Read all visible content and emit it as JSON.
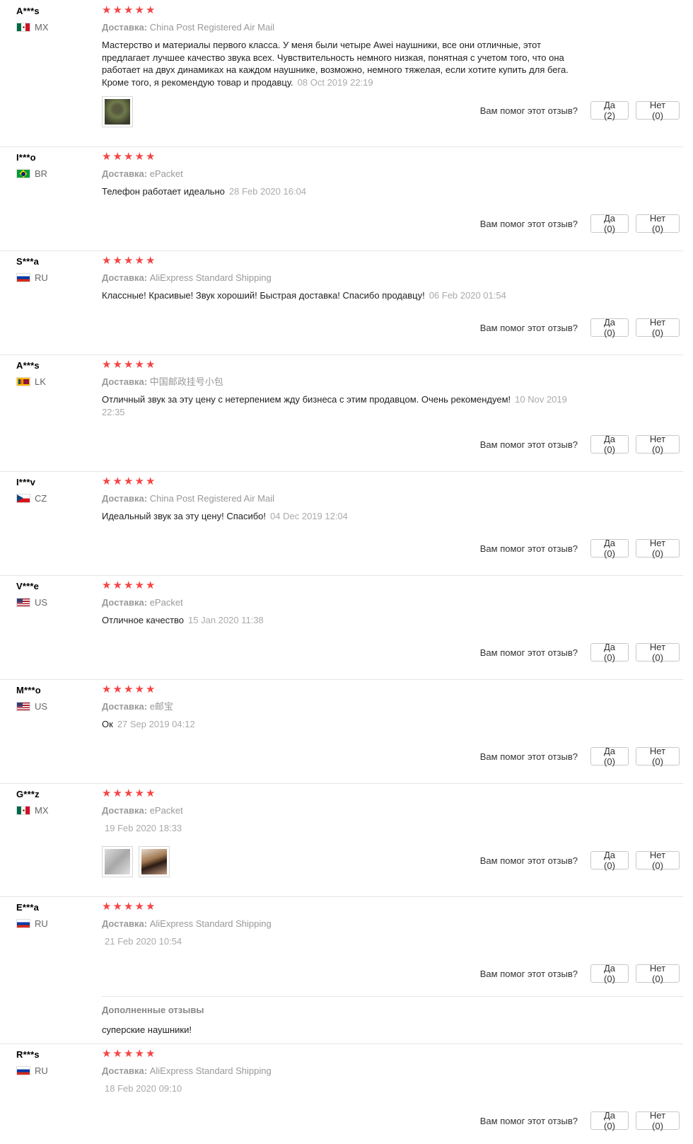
{
  "labels": {
    "shipping_prefix": "Доставка:",
    "helpful_question": "Вам помог этот отзыв?",
    "additional_title": "Дополненные отзывы"
  },
  "colors": {
    "star": "#f44545",
    "date": "#aaaaaa",
    "divider": "#e6e6e6"
  },
  "reviews": [
    {
      "user": "A***s",
      "country": "MX",
      "flag": "MX",
      "rating": 5,
      "shipping": "China Post Registered Air Mail",
      "text": "Мастерство и материалы первого класса. У меня были четыре Awei наушники, все они отличные, этот предлагает лучшее качество звука всех. Чувствительность немного низкая, понятная с учетом того, что она работает на двух динамиках на каждом наушнике, возможно, немного тяжелая, если хотите купить для бега. Кроме того, я рекомендую товар и продавцу.",
      "date": "08 Oct 2019 22:19",
      "photos": [
        "photo-a"
      ],
      "yes": "Да (2)",
      "no": "Нет (0)"
    },
    {
      "user": "I***o",
      "country": "BR",
      "flag": "BR",
      "rating": 5,
      "shipping": "ePacket",
      "text": "Телефон работает идеально",
      "date": "28 Feb 2020 16:04",
      "photos": [],
      "yes": "Да (0)",
      "no": "Нет (0)"
    },
    {
      "user": "S***a",
      "country": "RU",
      "flag": "RU",
      "rating": 5,
      "shipping": "AliExpress Standard Shipping",
      "text": "Классные! Красивые! Звук хороший! Быстрая доставка! Спасибо продавцу!",
      "date": "06 Feb 2020 01:54",
      "photos": [],
      "yes": "Да (0)",
      "no": "Нет (0)"
    },
    {
      "user": "A***s",
      "country": "LK",
      "flag": "LK",
      "rating": 5,
      "shipping": "中国邮政挂号小包",
      "text": "Отличный звук за эту цену с нетерпением жду бизнеса с этим продавцом. Очень рекомендуем!",
      "date": "10 Nov 2019 22:35",
      "photos": [],
      "yes": "Да (0)",
      "no": "Нет (0)"
    },
    {
      "user": "I***v",
      "country": "CZ",
      "flag": "CZ",
      "rating": 5,
      "shipping": "China Post Registered Air Mail",
      "text": "Идеальный звук за эту цену! Спасибо!",
      "date": "04 Dec 2019 12:04",
      "photos": [],
      "yes": "Да (0)",
      "no": "Нет (0)"
    },
    {
      "user": "V***e",
      "country": "US",
      "flag": "US",
      "rating": 5,
      "shipping": "ePacket",
      "text": "Отличное качество",
      "date": "15 Jan 2020 11:38",
      "photos": [],
      "yes": "Да (0)",
      "no": "Нет (0)"
    },
    {
      "user": "M***o",
      "country": "US",
      "flag": "US",
      "rating": 5,
      "shipping": "e邮宝",
      "text": "Ок",
      "date": "27 Sep 2019 04:12",
      "photos": [],
      "yes": "Да (0)",
      "no": "Нет (0)"
    },
    {
      "user": "G***z",
      "country": "MX",
      "flag": "MX",
      "rating": 5,
      "shipping": "ePacket",
      "text": "",
      "date": "19 Feb 2020 18:33",
      "photos": [
        "photo-b",
        "photo-c"
      ],
      "yes": "Да (0)",
      "no": "Нет (0)"
    },
    {
      "user": "E***a",
      "country": "RU",
      "flag": "RU",
      "rating": 5,
      "shipping": "AliExpress Standard Shipping",
      "text": "",
      "date": "21 Feb 2020 10:54",
      "photos": [],
      "yes": "Да (0)",
      "no": "Нет (0)",
      "additional": "суперские наушники!"
    },
    {
      "user": "R***s",
      "country": "RU",
      "flag": "RU",
      "rating": 5,
      "shipping": "AliExpress Standard Shipping",
      "text": "",
      "date": "18 Feb 2020 09:10",
      "photos": [],
      "yes": "Да (0)",
      "no": "Нет (0)"
    }
  ]
}
